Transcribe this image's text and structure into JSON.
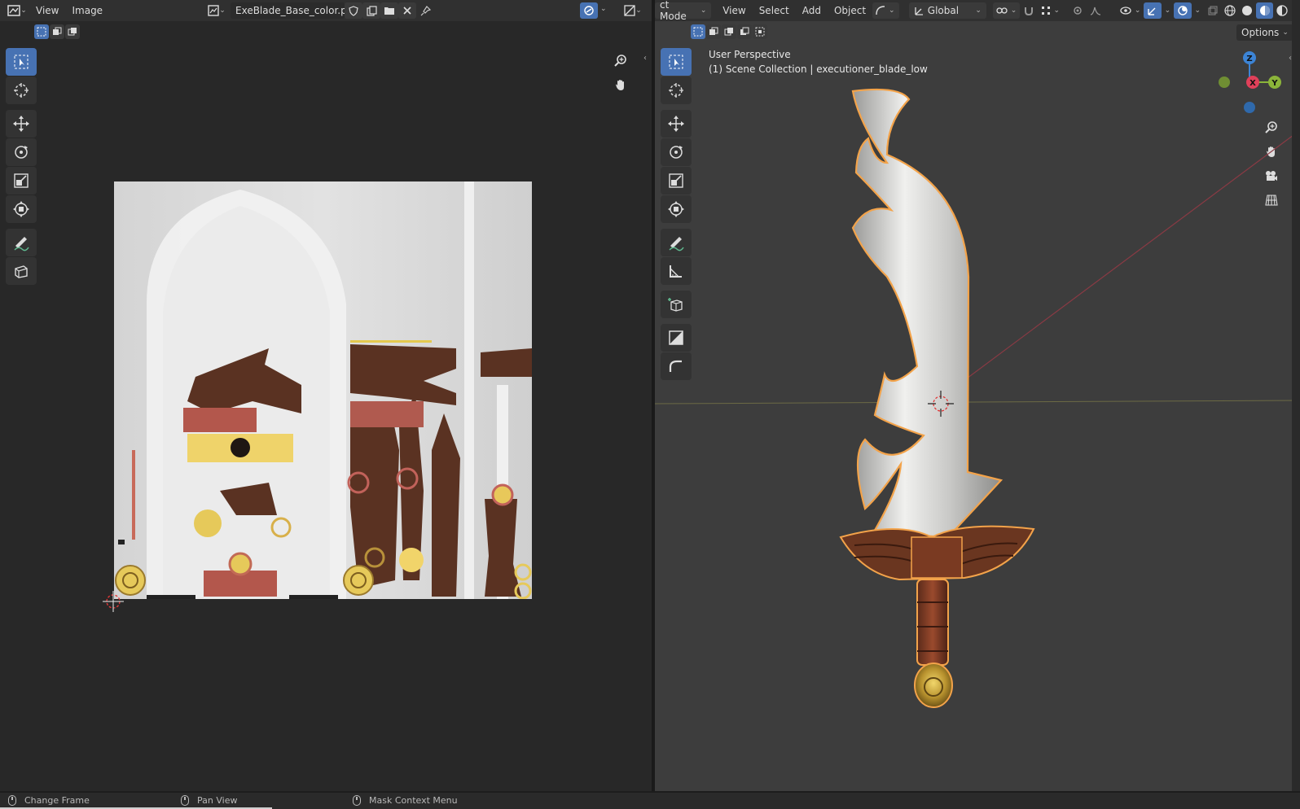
{
  "image_editor": {
    "menus": [
      "View",
      "Image"
    ],
    "image_name": "ExeBlade_Base_color.png"
  },
  "viewport": {
    "mode_label": "ct Mode",
    "menus": [
      "View",
      "Select",
      "Add",
      "Object"
    ],
    "orientation": "Global",
    "options_label": "Options",
    "overlay_title": "User Perspective",
    "overlay_subtitle": "(1) Scene Collection | executioner_blade_low",
    "gizmo": {
      "z": "Z",
      "x": "X",
      "y": "Y"
    }
  },
  "status_bar": {
    "items": [
      "Change Frame",
      "Pan View",
      "Mask Context Menu"
    ]
  },
  "colors": {
    "accent": "#4772b3",
    "selection_outline": "#f3a34a",
    "axis_x": "#e0405a",
    "axis_y": "#8bb43a",
    "axis_z": "#3c84d6"
  },
  "icons": [
    "editor-type-icon",
    "select-box-icon",
    "cursor-icon",
    "move-icon",
    "rotate-icon",
    "scale-icon",
    "transform-icon",
    "annotate-icon",
    "measure-icon",
    "add-cube-icon",
    "shield-icon",
    "duplicate-icon",
    "folder-icon",
    "close-icon",
    "pin-icon",
    "zoom-icon",
    "hand-icon",
    "camera-icon",
    "grid-icon"
  ]
}
